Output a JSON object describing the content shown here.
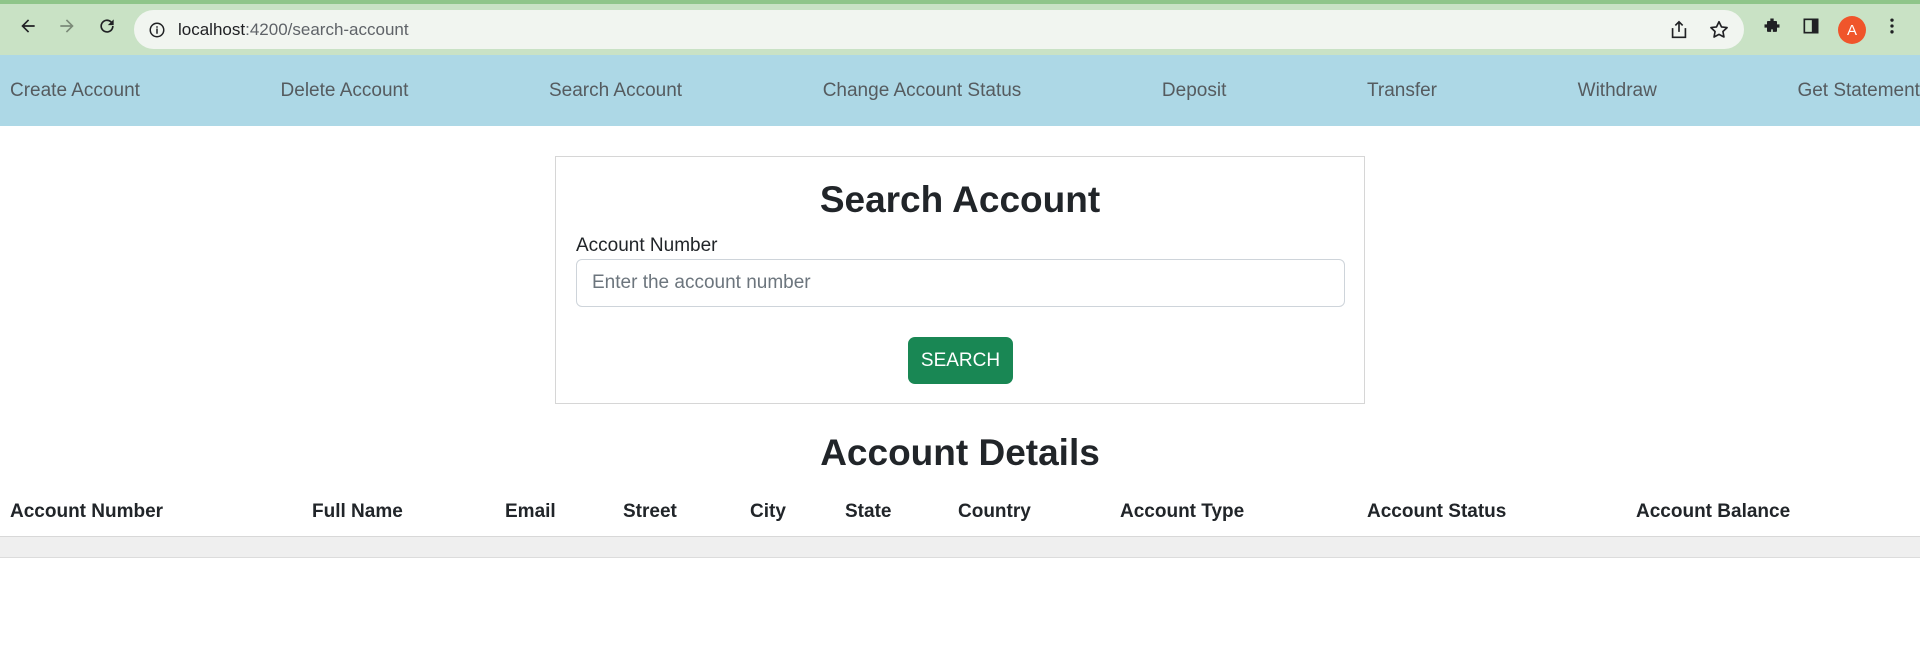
{
  "browser": {
    "url_host": "localhost",
    "url_path": ":4200/search-account",
    "profile_initial": "A"
  },
  "nav": {
    "items": [
      "Create Account",
      "Delete Account",
      "Search Account",
      "Change Account Status",
      "Deposit",
      "Transfer",
      "Withdraw",
      "Get Statement"
    ]
  },
  "search": {
    "title": "Search Account",
    "field_label": "Account Number",
    "placeholder": "Enter the account number",
    "button_label": "SEARCH",
    "button_color": "#198754"
  },
  "details": {
    "title": "Account Details",
    "columns": [
      "Account Number",
      "Full Name",
      "Email",
      "Street",
      "City",
      "State",
      "Country",
      "Account Type",
      "Account Status",
      "Account Balance"
    ]
  },
  "colors": {
    "nav_bg": "#add8e6",
    "chrome_bg": "#c9e2c5"
  }
}
